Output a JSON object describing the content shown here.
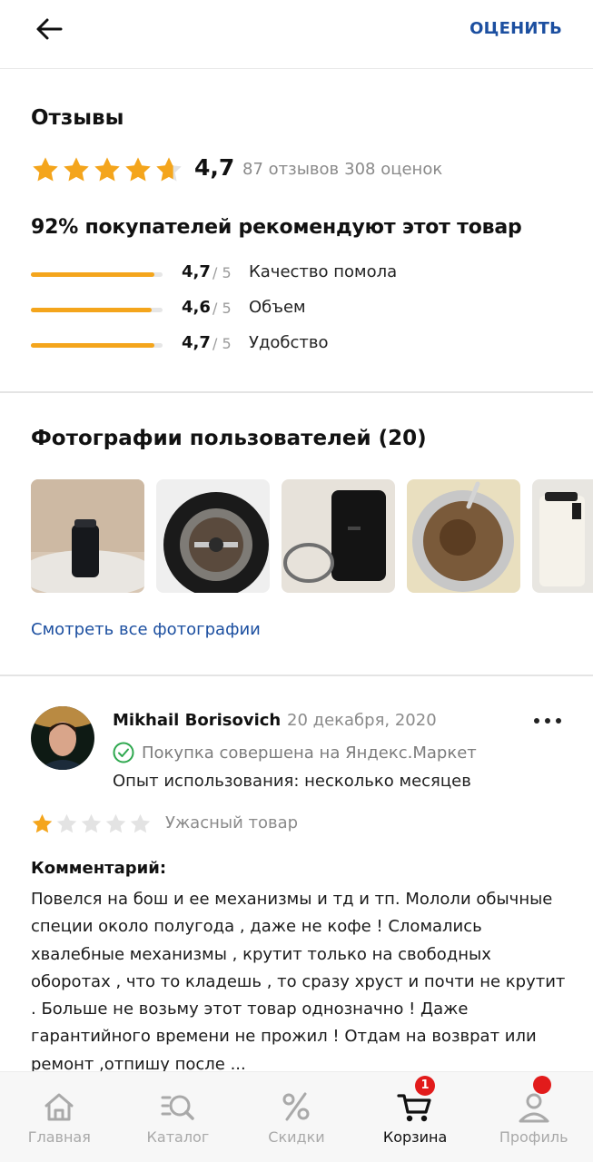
{
  "header": {
    "rate_label": "ОЦЕНИТЬ"
  },
  "reviews": {
    "title": "Отзывы",
    "rating": 4.7,
    "rating_label": "4,7",
    "reviews_count": "87 отзывов",
    "ratings_count": "308 оценок",
    "recommend_text": "92% покупателей рекомендуют этот товар",
    "criteria": [
      {
        "score": "4,7",
        "max": "/ 5",
        "label": "Качество помола",
        "value": 4.7
      },
      {
        "score": "4,6",
        "max": "/ 5",
        "label": "Объем",
        "value": 4.6
      },
      {
        "score": "4,7",
        "max": "/ 5",
        "label": "Удобство",
        "value": 4.7
      }
    ]
  },
  "photos": {
    "title": "Фотографии пользователей (20)",
    "see_all": "Смотреть все фотографии"
  },
  "review": {
    "author": "Mikhail Borisovich",
    "date": "20 декабря, 2020",
    "verified": "Покупка совершена на Яндекс.Маркет",
    "experience": "Опыт использования: несколько месяцев",
    "stars": 1,
    "verdict": "Ужасный товар",
    "comment_title": "Комментарий:",
    "comment": "Повелся на бош и ее механизмы и тд и тп. Мололи обычные специи около полугода , даже не кофе ! Сломались хвалебные механизмы  , крутит только на свободных оборотах , что то кладешь , то сразу хруст и почти не крутит . Больше не возьму этот товар однозначно ! Даже гарантийного времени не прожил ! Отдам на возврат или ремонт ,отпишу после ..."
  },
  "tabs": [
    {
      "label": "Главная",
      "icon": "home-icon"
    },
    {
      "label": "Каталог",
      "icon": "catalog-search-icon"
    },
    {
      "label": "Скидки",
      "icon": "percent-icon"
    },
    {
      "label": "Корзина",
      "icon": "cart-icon",
      "badge": "1",
      "active": true
    },
    {
      "label": "Профиль",
      "icon": "profile-icon"
    }
  ],
  "colors": {
    "accent": "#1c4fa0",
    "star": "#f4a51c",
    "badge": "#e21b1b"
  }
}
